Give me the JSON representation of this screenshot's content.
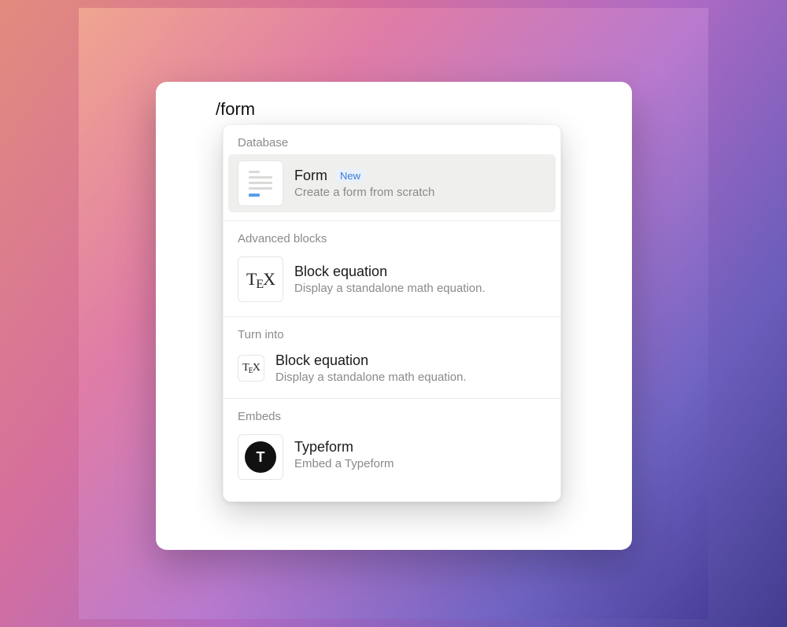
{
  "editor": {
    "command_text": "/form"
  },
  "menu": {
    "sections": [
      {
        "header": "Database",
        "items": [
          {
            "title": "Form",
            "badge": "New",
            "description": "Create a form from scratch",
            "icon": "form-icon",
            "selected": true
          }
        ]
      },
      {
        "header": "Advanced blocks",
        "items": [
          {
            "title": "Block equation",
            "description": "Display a standalone math equation.",
            "icon": "tex-icon"
          }
        ]
      },
      {
        "header": "Turn into",
        "items": [
          {
            "title": "Block equation",
            "description": "Display a standalone math equation.",
            "icon": "tex-icon-small"
          }
        ]
      },
      {
        "header": "Embeds",
        "items": [
          {
            "title": "Typeform",
            "description": "Embed a Typeform",
            "icon": "typeform-icon"
          }
        ]
      }
    ]
  }
}
